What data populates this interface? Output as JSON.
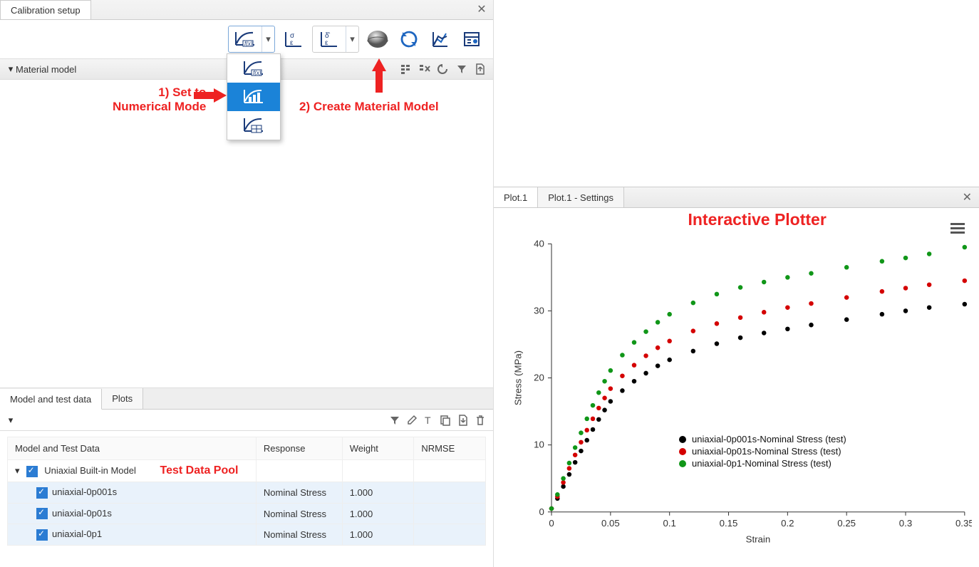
{
  "window": {
    "title": "Calibration setup"
  },
  "section": {
    "material_model": "Material model"
  },
  "annotations": {
    "step1a": "1) Set to",
    "step1b": "Numerical Mode",
    "step2": "2) Create Material Model",
    "plotter": "Interactive Plotter",
    "test_pool": "Test Data Pool"
  },
  "lower_tabs": {
    "model": "Model and test data",
    "plots": "Plots"
  },
  "table": {
    "headers": {
      "c1": "Model and Test Data",
      "c2": "Response",
      "c3": "Weight",
      "c4": "NRMSE"
    },
    "root": "Uniaxial Built-in Model",
    "rows": [
      {
        "name": "uniaxial-0p001s",
        "response": "Nominal Stress",
        "weight": "1.000",
        "nrmse": ""
      },
      {
        "name": "uniaxial-0p01s",
        "response": "Nominal Stress",
        "weight": "1.000",
        "nrmse": ""
      },
      {
        "name": "uniaxial-0p1",
        "response": "Nominal Stress",
        "weight": "1.000",
        "nrmse": ""
      }
    ]
  },
  "plot_tabs": {
    "t1": "Plot.1",
    "t2": "Plot.1 - Settings"
  },
  "chart_data": {
    "type": "scatter",
    "title": "",
    "xlabel": "Strain",
    "ylabel": "Stress (MPa)",
    "xlim": [
      0,
      0.35
    ],
    "ylim": [
      0,
      40
    ],
    "xticks": [
      0,
      0.05,
      0.1,
      0.15,
      0.2,
      0.25,
      0.3,
      0.35
    ],
    "yticks": [
      0,
      10,
      20,
      30,
      40
    ],
    "legend_position": "bottom-right-inside",
    "series": [
      {
        "name": "uniaxial-0p001s-Nominal Stress (test)",
        "color": "#000000",
        "x": [
          0.0,
          0.005,
          0.01,
          0.015,
          0.02,
          0.025,
          0.03,
          0.035,
          0.04,
          0.045,
          0.05,
          0.06,
          0.07,
          0.08,
          0.09,
          0.1,
          0.12,
          0.14,
          0.16,
          0.18,
          0.2,
          0.22,
          0.25,
          0.28,
          0.3,
          0.32,
          0.35
        ],
        "y": [
          0.5,
          2.0,
          3.8,
          5.6,
          7.4,
          9.1,
          10.7,
          12.3,
          13.8,
          15.2,
          16.5,
          18.1,
          19.5,
          20.7,
          21.8,
          22.7,
          24.0,
          25.1,
          26.0,
          26.7,
          27.3,
          27.9,
          28.7,
          29.5,
          30.0,
          30.5,
          31.0
        ]
      },
      {
        "name": "uniaxial-0p01s-Nominal Stress (test)",
        "color": "#d40000",
        "x": [
          0.0,
          0.005,
          0.01,
          0.015,
          0.02,
          0.025,
          0.03,
          0.035,
          0.04,
          0.045,
          0.05,
          0.06,
          0.07,
          0.08,
          0.09,
          0.1,
          0.12,
          0.14,
          0.16,
          0.18,
          0.2,
          0.22,
          0.25,
          0.28,
          0.3,
          0.32,
          0.35
        ],
        "y": [
          0.5,
          2.3,
          4.4,
          6.5,
          8.5,
          10.4,
          12.2,
          13.9,
          15.5,
          17.0,
          18.4,
          20.3,
          21.9,
          23.3,
          24.5,
          25.5,
          27.0,
          28.1,
          29.0,
          29.8,
          30.5,
          31.1,
          32.0,
          32.9,
          33.4,
          33.9,
          34.5
        ]
      },
      {
        "name": "uniaxial-0p1-Nominal Stress (test)",
        "color": "#109618",
        "x": [
          0.0,
          0.005,
          0.01,
          0.015,
          0.02,
          0.025,
          0.03,
          0.035,
          0.04,
          0.045,
          0.05,
          0.06,
          0.07,
          0.08,
          0.09,
          0.1,
          0.12,
          0.14,
          0.16,
          0.18,
          0.2,
          0.22,
          0.25,
          0.28,
          0.3,
          0.32,
          0.35
        ],
        "y": [
          0.5,
          2.6,
          5.0,
          7.3,
          9.6,
          11.8,
          13.9,
          15.9,
          17.8,
          19.5,
          21.1,
          23.4,
          25.3,
          26.9,
          28.3,
          29.5,
          31.2,
          32.5,
          33.5,
          34.3,
          35.0,
          35.6,
          36.5,
          37.4,
          37.9,
          38.5,
          39.5
        ]
      }
    ]
  }
}
